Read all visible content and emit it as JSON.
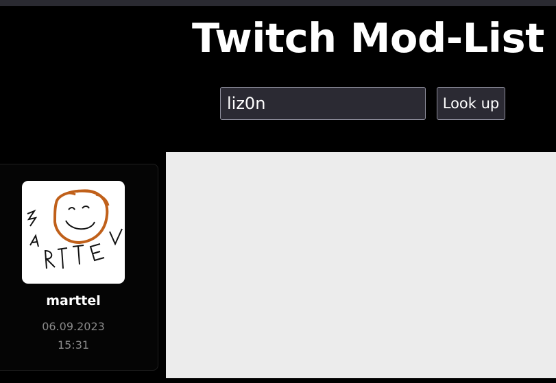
{
  "header": {
    "title": "Twitch Mod-List"
  },
  "search": {
    "value": "liz0n",
    "button_label": "Look up"
  },
  "mods": [
    {
      "name": "marttel",
      "date": "06.09.2023",
      "time": "15:31",
      "avatar_text": "3ARTTEL"
    }
  ],
  "colors": {
    "background": "#000000",
    "topbar": "#2a2a31",
    "input_bg": "#2b2a33",
    "input_border": "#8f8f9d",
    "card_bg": "#050505",
    "panel_bg": "#ececec",
    "muted_text": "#8a8a8a",
    "avatar_hair": "#c0601a"
  }
}
